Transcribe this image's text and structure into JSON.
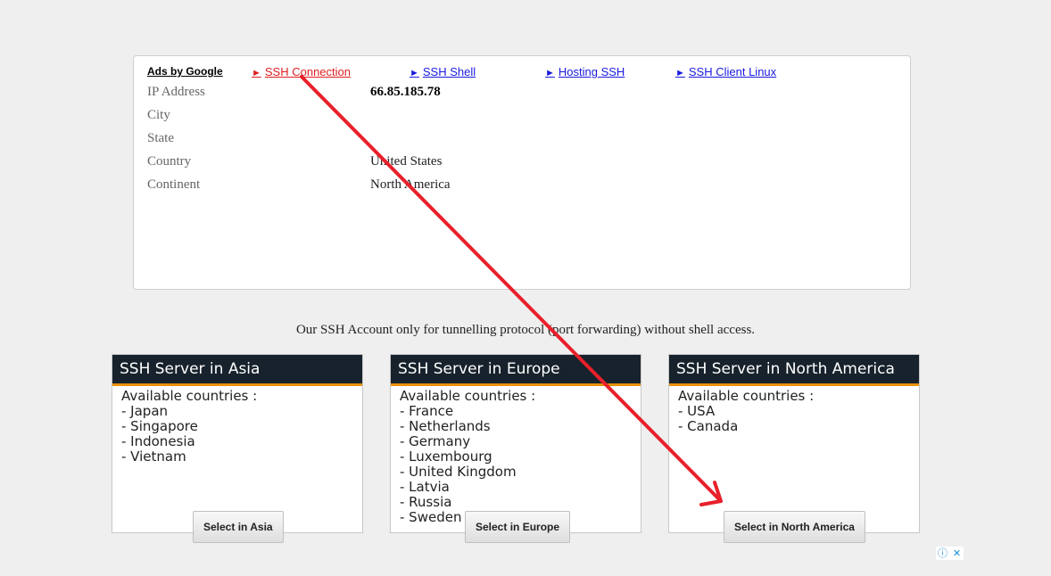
{
  "ads": {
    "label": "Ads by Google",
    "links": [
      {
        "text": "SSH Connection",
        "color": "#e02020"
      },
      {
        "text": "SSH Shell",
        "color": "#1a1ae0"
      },
      {
        "text": "Hosting SSH",
        "color": "#1a1ae0"
      },
      {
        "text": "SSH Client Linux",
        "color": "#1a1ae0"
      }
    ],
    "triangle_glyph": "►"
  },
  "geo": [
    {
      "key": "IP Address",
      "value": "66.85.185.78"
    },
    {
      "key": "City",
      "value": ""
    },
    {
      "key": "State",
      "value": ""
    },
    {
      "key": "Country",
      "value": "United States"
    },
    {
      "key": "Continent",
      "value": "North America"
    }
  ],
  "notice": "Our SSH Account only for tunnelling protocol (port forwarding) without shell access.",
  "servers": [
    {
      "title": "SSH Server in Asia",
      "available_label": "Available countries :",
      "countries": [
        "- Japan",
        "- Singapore",
        "- Indonesia",
        "- Vietnam"
      ],
      "button": "Select in Asia"
    },
    {
      "title": "SSH Server in Europe",
      "available_label": "Available countries :",
      "countries": [
        "- France",
        "- Netherlands",
        "- Germany",
        "- Luxembourg",
        "- United Kingdom",
        "- Latvia",
        "- Russia",
        "- Sweden"
      ],
      "button": "Select in Europe"
    },
    {
      "title": "SSH Server in North America",
      "available_label": "Available countries :",
      "countries": [
        "- USA",
        "- Canada"
      ],
      "button": "Select in North America"
    }
  ],
  "adchoices": {
    "info_glyph": "ⓘ",
    "close_glyph": "✕"
  },
  "colors": {
    "accent_orange": "#e8900c",
    "header_dark": "#17222c",
    "annotation_red": "#e8202a"
  }
}
